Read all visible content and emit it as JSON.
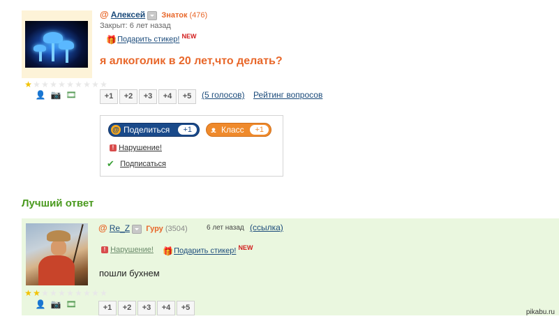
{
  "question": {
    "author": {
      "name": "Алексей",
      "rank": "Знаток",
      "points": "(476)"
    },
    "closed": "Закрыт: 6 лет назад",
    "gift_label": "Подарить стикер!",
    "new_badge": "NEW",
    "title": "я алкоголик в 20 лет,что делать?",
    "stars": {
      "filled": 1,
      "total": 10
    },
    "vote_buttons": [
      "+1",
      "+2",
      "+3",
      "+4",
      "+5"
    ],
    "votes_link": "(5 голосов)",
    "rating_link": "Рейтинг вопросов"
  },
  "share": {
    "mail_label": "Поделиться",
    "mail_count": "+1",
    "ok_label": "Класс",
    "ok_count": "+1",
    "report_label": "Нарушение!",
    "subscribe_label": "Подписаться"
  },
  "best_answer": {
    "heading": "Лучший ответ",
    "author": {
      "name": "Re_Z",
      "rank": "Гуру",
      "points": "(3504)"
    },
    "time": "6 лет назад",
    "link_label": "(ссылка)",
    "report_label": "Нарушение!",
    "gift_label": "Подарить стикер!",
    "new_badge": "NEW",
    "text": "пошли бухнем",
    "stars": {
      "filled": 2,
      "total": 10
    },
    "vote_buttons": [
      "+1",
      "+2",
      "+3",
      "+4",
      "+5"
    ]
  },
  "watermark": "pikabu.ru",
  "icons": [
    "at-icon",
    "dropdown-icon",
    "gift-icon",
    "star-icon",
    "user-icon",
    "photo-icon",
    "video-icon",
    "warning-icon",
    "subscribe-icon"
  ],
  "colors": {
    "accent_orange": "#e8672a",
    "link_blue": "#1a4a7a",
    "best_green": "#4a9a1f",
    "answer_bg": "#eaf7df",
    "question_avatar_bg": "#fdf3d8"
  }
}
